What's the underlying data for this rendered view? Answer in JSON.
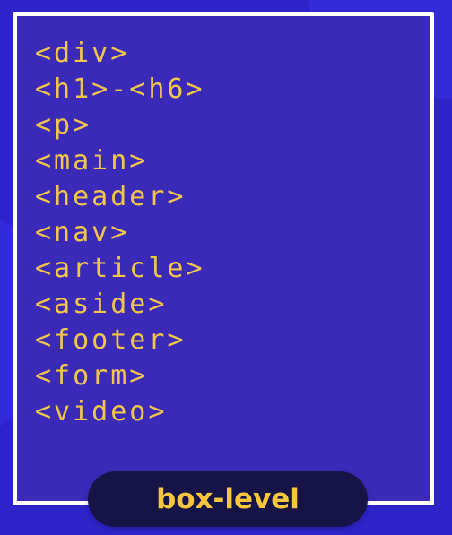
{
  "colors": {
    "background": "#2d23c9",
    "panel": "#3b2ab8",
    "frame_border": "#ffffff",
    "tag_text": "#f0c64a",
    "badge_background": "#161347",
    "badge_text": "#f6c63d"
  },
  "tags": [
    "<div>",
    "<h1>-<h6>",
    "<p>",
    "<main>",
    "<header>",
    "<nav>",
    "<article>",
    "<aside>",
    "<footer>",
    "<form>",
    "<video>"
  ],
  "badge": {
    "label": "box-level"
  }
}
